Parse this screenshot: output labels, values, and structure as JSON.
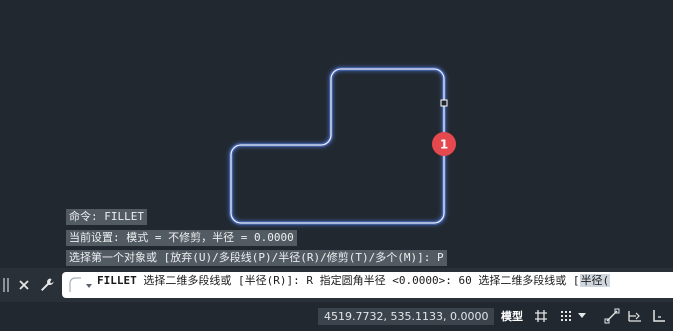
{
  "canvas": {
    "background": "#212830",
    "outline_color": "#dfe9ff",
    "glow_color": "#5d8bff",
    "marker": {
      "number": "1",
      "color": "#e5484d"
    }
  },
  "history": [
    "命令: FILLET",
    "当前设置: 模式 = 不修剪，半径 = 0.0000",
    "选择第一个对象或 [放弃(U)/多段线(P)/半径(R)/修剪(T)/多个(M)]: P"
  ],
  "command_line": {
    "command": "FILLET",
    "text": " 选择二维多段线或 [半径(R)]: R 指定圆角半径 <0.0000>: 60 选择二维多段线或 [",
    "option": "半径(",
    "icons": {
      "close": "close-icon",
      "customize": "wrench-icon",
      "recent": "recent-commands-icon"
    }
  },
  "status_bar": {
    "coordinates": "4519.7732, 535.1133, 0.0000",
    "model_label": "模型",
    "icons": [
      "grid-icon",
      "snap-dots-icon",
      "snap-dropdown-icon",
      "ortho-icon",
      "polar-icon",
      "osnap-icon"
    ]
  }
}
